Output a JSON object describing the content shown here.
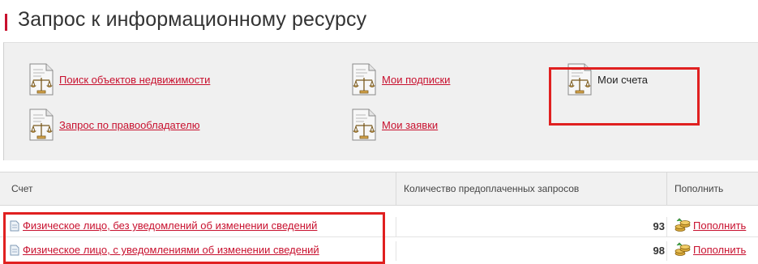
{
  "page": {
    "title": "Запрос к информационному ресурсу"
  },
  "links": [
    {
      "label": "Поиск объектов недвижимости",
      "icon": "document-scales-icon"
    },
    {
      "label": "Мои подписки",
      "icon": "document-scales-icon"
    },
    {
      "label": "Мои счета",
      "icon": "document-scales-icon",
      "active": true
    },
    {
      "label": "Запрос по правообладателю",
      "icon": "document-scales-icon"
    },
    {
      "label": "Мои заявки",
      "icon": "document-scales-icon"
    }
  ],
  "table": {
    "columns": [
      "Счет",
      "Количество предоплаченных запросов",
      "Пополнить"
    ],
    "rows": [
      {
        "account": "Физическое лицо, без уведомлений об изменении сведений",
        "count": "93",
        "action": "Пополнить"
      },
      {
        "account": "Физическое лицо, с уведомлениями об изменении сведений",
        "count": "98",
        "action": "Пополнить"
      }
    ]
  },
  "colors": {
    "link": "#c8102e",
    "highlight": "#e02020",
    "panel": "#f0f0f0"
  }
}
